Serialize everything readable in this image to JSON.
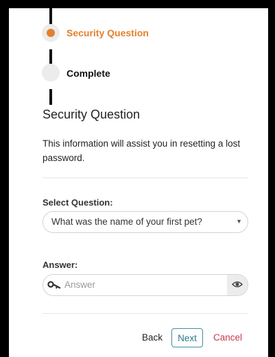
{
  "stepper": {
    "steps": [
      {
        "label": "Security Question",
        "state": "active",
        "color": "#e3802d"
      },
      {
        "label": "Complete",
        "state": "pending"
      }
    ]
  },
  "form": {
    "title": "Security Question",
    "description": "This information will assist you in resetting a lost password.",
    "question_label": "Select Question:",
    "question_value": "What was the name of your first pet?",
    "answer_label": "Answer:",
    "answer_placeholder": "Answer",
    "answer_value": ""
  },
  "actions": {
    "back_label": "Back",
    "next_label": "Next",
    "cancel_label": "Cancel"
  },
  "icons": {
    "answer_prefix": "key-icon",
    "answer_toggle": "eye-icon",
    "select_caret": "caret-down-icon"
  },
  "colors": {
    "accent_orange": "#e3802d",
    "next_teal": "#2b7a8c",
    "cancel_red": "#c9374b"
  }
}
